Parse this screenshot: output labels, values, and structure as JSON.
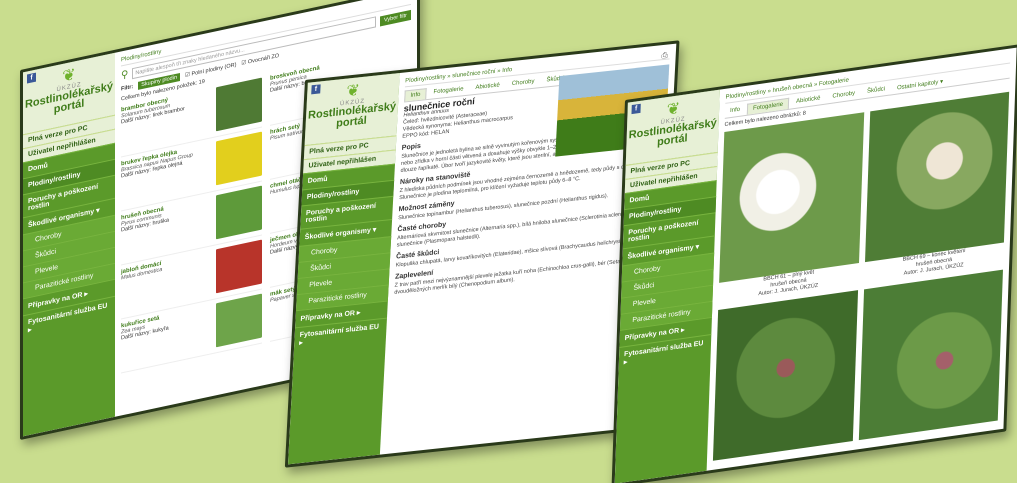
{
  "portal": {
    "brand_small": "ÚKZÚZ",
    "brand_line1": "Rostlinolékařský",
    "brand_line2": "portál",
    "fb": "f",
    "full_version": "Plná verze pro PC",
    "login": "Uživatel nepřihlášen",
    "menu": [
      "Domů",
      "Plodiny/rostliny",
      "Poruchy a poškození rostlin",
      "Škodlivé organismy ▾",
      "Choroby",
      "Škůdci",
      "Plevele",
      "Parazitické rostliny",
      "Přípravky na OR ▸",
      "Fytosanitární služba EU ▸"
    ]
  },
  "s1": {
    "breadcrumb": "Plodiny/rostliny",
    "search_placeholder": "Napište alespoň tři znaky hledaného názvu...",
    "search_button": "Vyber filtr",
    "close": "×",
    "filter_label": "Filtr:",
    "filter_chip": "Skupiny plodin",
    "cb1": "Polní plodiny (OR)",
    "cb2": "Ovocnáři ZO",
    "count": "Celkem bylo nalezeno položek: 19",
    "items": [
      {
        "name": "brambor obecný",
        "lat": "Solanum tuberosum",
        "other": "Další názvy: Iirek brambor",
        "color": "#4f7a34"
      },
      {
        "name": "brukev řepka olejka",
        "lat": "Brassica napus Napus Group",
        "other": "Další názvy: řepka olejná",
        "color": "#e2cf1d"
      },
      {
        "name": "hrušeň obecná",
        "lat": "Pyrus communis",
        "other": "Další názvy: hruška",
        "color": "#5e9a3a"
      },
      {
        "name": "jabloň domácí",
        "lat": "Malus domestica",
        "other": "",
        "color": "#b8342a"
      },
      {
        "name": "kukuřice setá",
        "lat": "Zea mays",
        "other": "Další názvy: kukyřa",
        "color": "#6ea44a"
      }
    ],
    "items_right": [
      {
        "name": "broskvoň obecná",
        "lat": "Prunus persica",
        "other": "Další názvy: br"
      },
      {
        "name": "hrách setý",
        "lat": "Pisum sativum",
        "other": ""
      },
      {
        "name": "chmel otáčivý",
        "lat": "Humulus lupulus",
        "other": ""
      },
      {
        "name": "ječmen obecný",
        "lat": "Hordeum vulgare",
        "other": "Další názvy: j"
      },
      {
        "name": "mák setý",
        "lat": "Papaver somniferum",
        "other": ""
      }
    ]
  },
  "s2": {
    "breadcrumb": "Plodiny/rostliny » slunečnice roční » Info",
    "tabs": [
      "Info",
      "Fotogalerie",
      "Abiotické",
      "Choroby",
      "Škůdci",
      "Ostatní kapitoly ▾"
    ],
    "title": "slunečnice roční",
    "lat": "Helianthus annuus",
    "family": "Čeleď: hvězdnicovité (Asteraceae)",
    "synonym": "Vědecká synonyma: Helianthus macrocarpus",
    "eppo": "EPPO kód: HELAN",
    "h_desc": "Popis",
    "desc": "Slunečnice je jednoletá bylina se silně vyvinutým kořenovým systémem. Přímá lodyha je většinou nevětvená nebo zřídka v horní části větvená a dosahuje výšky obvykle 1–2,5 m. Spodní a horní listy jsou střídavé, dlouze řapíkaté. Úbor tvoří jazykovité květy, které jsou sterilní, a trubkovité plodné květy. Plodem je nažka.",
    "h_req": "Nároky na stanoviště",
    "req": "Z hlediska půdních podmínek jsou vhodné zejména černozemě a hnědozemě, tedy půdy s dostatkem živin. Slunečnice je plodina teplomilná, pro klíčení vyžaduje teplotu půdy 6–8 °C.",
    "h_conf": "Možnost záměny",
    "conf": "Slunečnice topinambur (Helianthus tuberosus), slunečnice pozdní (Helianthus rigidus).",
    "h_dis": "Časté choroby",
    "dis": "Alternáriová skvrnitost slunečnice (Alternaria spp.), bílá hniloba slunečnice (Sclerotinia sclerotiorum), plíseň slunečnice (Plasmopara halstedii).",
    "h_pest": "Časté škůdci",
    "pest": "Klopuška chlupatá, larvy kovaříkovitých (Elateridae), mšice slívová (Brachycaudus helichrysi).",
    "h_weed": "Zaplevelení",
    "weed": "Z trav patří mezi nejvýznamnější plevele ježatka kuří noha (Echinochloa crus-galli), bér (Setaria spp.), z dvouděložných merlík bílý (Chenopodium album)."
  },
  "s3": {
    "breadcrumb": "Plodiny/rostliny » hrušeň obecná » Fotogalerie",
    "tabs": [
      "Info",
      "Fotogalerie",
      "Abiotické",
      "Choroby",
      "Škůdci",
      "Ostatní kapitoly ▾"
    ],
    "count": "Celkem bylo nalezeno obrázků: 8",
    "photos": [
      {
        "cap": "BBCH 61 – plný květ",
        "name": "hrušeň obecná",
        "author": "Autor: J. Jurach, ÚKZÚZ",
        "color": "#f4f4ef"
      },
      {
        "cap": "BBCH 69 – konec květení",
        "name": "hrušeň obecná",
        "author": "Autor: J. Jurach, ÚKZÚZ",
        "color": "#6f9a4a"
      },
      {
        "cap": "",
        "name": "",
        "author": "",
        "color": "#4c7d36"
      },
      {
        "cap": "",
        "name": "",
        "author": "",
        "color": "#5f8c3e"
      }
    ]
  },
  "colors": {
    "accent": "#5b9a2a",
    "background": "#c9dd8e"
  }
}
